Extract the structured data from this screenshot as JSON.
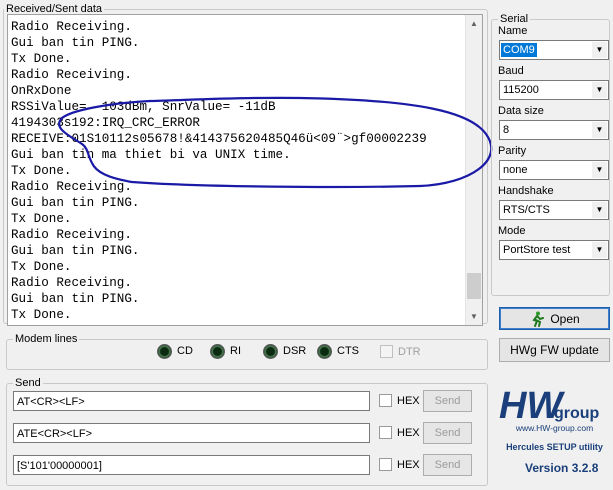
{
  "received": {
    "title": "Received/Sent data",
    "lines": [
      "Radio Receiving.",
      "Gui ban tin PING.",
      "Tx Done.",
      "Radio Receiving.",
      "OnRxDone",
      "RSSiValue= -103dBm, SnrValue= -11dB",
      "4194303s192:IRQ_CRC_ERROR",
      "RECEIVE:01S10112s05678!&414375620485Q46ü<09¨>gf00002239",
      "Gui ban tin ma thiet bi va UNIX time.",
      "Tx Done.",
      "Radio Receiving.",
      "Gui ban tin PING.",
      "Tx Done.",
      "Radio Receiving.",
      "Gui ban tin PING.",
      "Tx Done.",
      "Radio Receiving.",
      "Gui ban tin PING.",
      "Tx Done."
    ],
    "annotation_color": "#1a1aa6"
  },
  "modem": {
    "title": "Modem lines",
    "leds": [
      "CD",
      "RI",
      "DSR",
      "CTS"
    ],
    "dtr_label": "DTR"
  },
  "send": {
    "title": "Send",
    "rows": [
      {
        "value": "AT<CR><LF>",
        "hex_label": "HEX",
        "button": "Send"
      },
      {
        "value": "ATE<CR><LF>",
        "hex_label": "HEX",
        "button": "Send"
      },
      {
        "value": "[S'101'00000001]",
        "hex_label": "HEX",
        "button": "Send"
      }
    ]
  },
  "serial": {
    "title": "Serial",
    "name_label": "Name",
    "name_value": "COM9",
    "baud_label": "Baud",
    "baud_value": "115200",
    "datasize_label": "Data size",
    "datasize_value": "8",
    "parity_label": "Parity",
    "parity_value": "none",
    "handshake_label": "Handshake",
    "handshake_value": "RTS/CTS",
    "mode_label": "Mode",
    "mode_value": "PortStore test",
    "open_button": "Open",
    "fw_button": "HWg FW update"
  },
  "logo": {
    "brand": "HW",
    "brand_sub": "group",
    "url": "www.HW-group.com",
    "tagline": "Hercules SETUP utility",
    "version": "Version  3.2.8",
    "color": "#1a3f7a"
  }
}
